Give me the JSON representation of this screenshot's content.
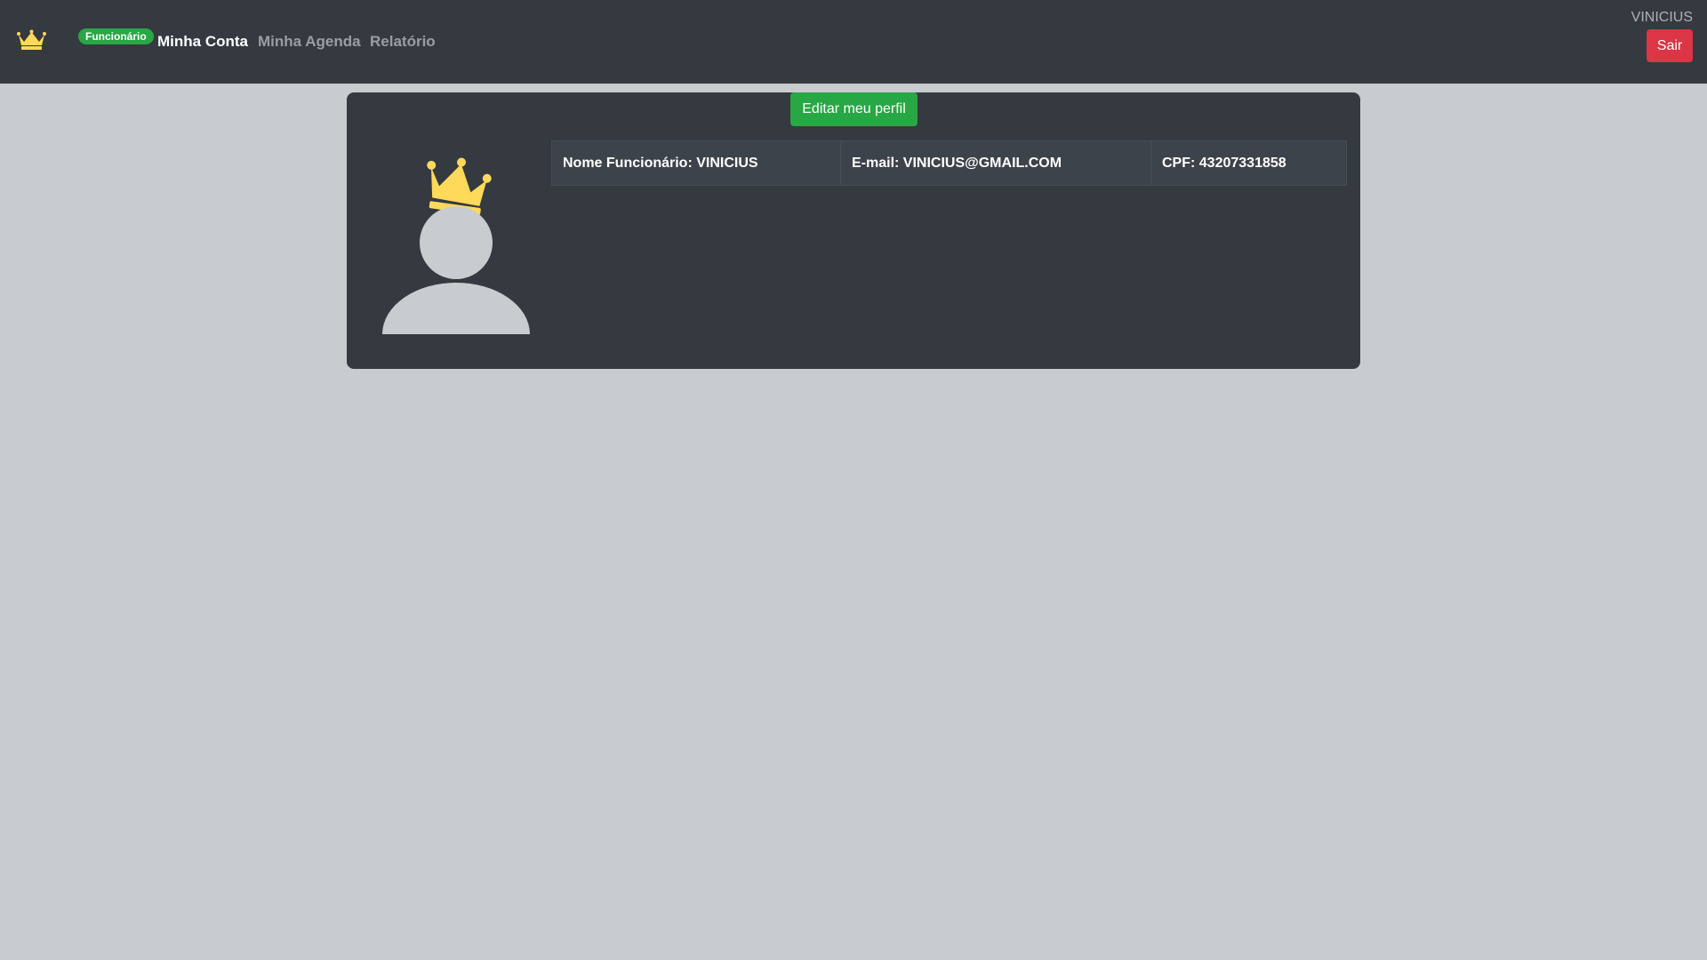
{
  "navbar": {
    "brand_icon": "crown-icon",
    "role_badge": "Funcionário",
    "links": [
      {
        "label": "Minha Conta",
        "active": true
      },
      {
        "label": "Minha Agenda",
        "active": false
      },
      {
        "label": "Relatório",
        "active": false
      }
    ],
    "username": "VINICIUS",
    "logout_label": "Sair"
  },
  "profile": {
    "edit_label": "Editar meu perfil",
    "avatar_icon": "crowned-user-avatar-icon",
    "name": "Nome Funcionário: VINICIUS",
    "email": "E-mail: VINICIUS@GMAIL.COM",
    "cpf": "CPF: 43207331858"
  },
  "colors": {
    "navbar_bg": "#343a40",
    "page_bg": "#c8cccf",
    "success": "#28a745",
    "danger": "#dc3545",
    "crown": "#ffd95a"
  }
}
